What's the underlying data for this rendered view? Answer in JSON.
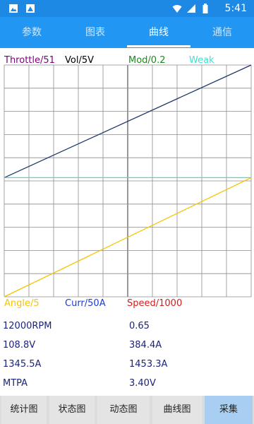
{
  "status_bar": {
    "time": "5:41",
    "icons": [
      "photo-icon",
      "photo-icon",
      "wifi-icon",
      "signal-icon",
      "battery-icon"
    ]
  },
  "tabs": [
    {
      "label": "参数",
      "active": false
    },
    {
      "label": "图表",
      "active": false
    },
    {
      "label": "曲线",
      "active": true
    },
    {
      "label": "通信",
      "active": false
    }
  ],
  "legend_top": {
    "throttle": "Throttle/51",
    "vol": "Vol/5V",
    "mod": "Mod/0.2",
    "weak": "Weak"
  },
  "legend_bottom": {
    "angle": "Angle/5",
    "curr": "Curr/50A",
    "speed": "Speed/1000"
  },
  "colors": {
    "throttle": "#800080",
    "vol": "#000000",
    "mod": "#1a8a1a",
    "weak": "#40e0d0",
    "angle": "#f5c400",
    "curr": "#1a3ad6",
    "speed": "#d81b1b",
    "values": "#1a237e",
    "accent": "#2196f3"
  },
  "chart_data": {
    "type": "line",
    "grid": true,
    "series": [
      {
        "name": "",
        "color": "#1f3a68",
        "start": [
          0.0,
          0.514
        ],
        "end": [
          1.0,
          1.0
        ]
      },
      {
        "name": "",
        "color": "#40e0d0",
        "start": [
          0.0,
          0.514
        ],
        "end": [
          1.0,
          0.514
        ]
      },
      {
        "name": "",
        "color": "#f5c400",
        "start": [
          0.0,
          0.0
        ],
        "end": [
          1.0,
          0.514
        ]
      }
    ]
  },
  "readings": [
    [
      "12000RPM",
      "0.65"
    ],
    [
      "108.8V",
      "384.4A"
    ],
    [
      "1345.5A",
      "1453.3A"
    ],
    [
      "MTPA",
      "3.40V"
    ]
  ],
  "buttons": [
    {
      "label": "统计图"
    },
    {
      "label": "状态图"
    },
    {
      "label": "动态图"
    },
    {
      "label": "曲线图"
    },
    {
      "label": "采集"
    }
  ]
}
